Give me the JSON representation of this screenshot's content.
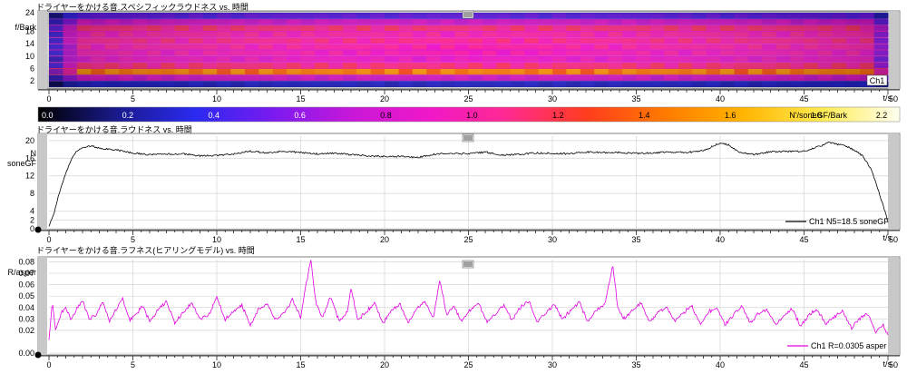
{
  "colors": {
    "panel_border": "#808080",
    "grid": "#d4d4d4",
    "track": "#c8c8c8",
    "loudness_line": "#000000",
    "roughness_line": "#e000e0",
    "ruler": "#000000"
  },
  "icons": {
    "cursor_marker": "cursor-marker-icon",
    "origin_dot": "origin-dot-icon"
  },
  "chart_data": [
    {
      "type": "heatmap",
      "title": "ドライヤーをかける音.スペシフィックラウドネス vs. 時間",
      "ylabel": "f/Bark",
      "xlabel": "t/s",
      "xlim": [
        0,
        50
      ],
      "ylim": [
        0,
        24
      ],
      "yticks": [
        "24",
        "18",
        "14",
        "10",
        "6",
        "2"
      ],
      "xticks": [
        "0",
        "5",
        "10",
        "15",
        "20",
        "25",
        "30",
        "35",
        "40",
        "45",
        "50"
      ],
      "channel_label": "Ch1",
      "colorbar": {
        "ticks": [
          "0.0",
          "0.2",
          "0.4",
          "0.6",
          "0.8",
          "1.0",
          "1.2",
          "1.4",
          "1.6",
          "1.8",
          "2.2"
        ],
        "unit": "N'/soneGF/Bark",
        "range": [
          0,
          2.2
        ],
        "stops": [
          "#000000",
          "#1a1a8c",
          "#2a2af0",
          "#7a1af0",
          "#c818d8",
          "#f018c8",
          "#ff2a90",
          "#ff3c1e",
          "#ff7a00",
          "#ffb400",
          "#ffeb50",
          "#fffff0"
        ]
      },
      "band_intensity": [
        {
          "bark": 1,
          "level": 0.35
        },
        {
          "bark": 3,
          "level": 0.9
        },
        {
          "bark": 5,
          "level": 1.6
        },
        {
          "bark": 7,
          "level": 1.2
        },
        {
          "bark": 9,
          "level": 1.0
        },
        {
          "bark": 11,
          "level": 1.05
        },
        {
          "bark": 13,
          "level": 1.1
        },
        {
          "bark": 15,
          "level": 1.15
        },
        {
          "bark": 17,
          "level": 1.1
        },
        {
          "bark": 19,
          "level": 1.2
        },
        {
          "bark": 21,
          "level": 0.9
        },
        {
          "bark": 23,
          "level": 0.55
        }
      ]
    },
    {
      "type": "line",
      "title": "ドライヤーをかける音.ラウドネス vs. 時間",
      "ylabel": "N\nsoneGF",
      "ylabel_lines": [
        "N",
        "soneGF"
      ],
      "xlabel": "t/s",
      "xlim": [
        0,
        50
      ],
      "ylim": [
        0,
        21
      ],
      "yticks": [
        "20",
        "16",
        "12",
        "8",
        "4",
        "2",
        "0"
      ],
      "xticks": [
        "0",
        "5",
        "10",
        "15",
        "20",
        "25",
        "30",
        "35",
        "40",
        "45",
        "50"
      ],
      "series": [
        {
          "name": "Ch1 N5=18.5 soneGF",
          "x": [
            0.0,
            0.3,
            0.6,
            1.0,
            1.3,
            1.6,
            2.0,
            2.5,
            3.0,
            4,
            5,
            6,
            7,
            8,
            9,
            10,
            11,
            12,
            13,
            14,
            15,
            16,
            17,
            18,
            19,
            20,
            21,
            22,
            23,
            24,
            25,
            26,
            27,
            28,
            29,
            30,
            31,
            32,
            33,
            34,
            35,
            36,
            37,
            38,
            39,
            40,
            40.5,
            41,
            42,
            43,
            44,
            45,
            46,
            46.5,
            47,
            47.5,
            48,
            48.5,
            49.0,
            49.4,
            49.7,
            50.0
          ],
          "y": [
            0.5,
            3.5,
            8.0,
            12.5,
            15.5,
            17.5,
            18.4,
            18.8,
            18.3,
            17.9,
            17.2,
            16.8,
            16.9,
            17.0,
            16.5,
            16.6,
            17.0,
            17.6,
            17.2,
            17.6,
            17.3,
            17.0,
            17.1,
            16.8,
            16.5,
            16.4,
            16.4,
            16.2,
            16.9,
            17.1,
            17.0,
            17.4,
            16.7,
            16.9,
            17.2,
            17.1,
            17.0,
            17.4,
            17.3,
            17.3,
            17.1,
            17.2,
            17.4,
            17.3,
            17.7,
            19.5,
            19.0,
            17.6,
            16.8,
            17.5,
            17.5,
            17.6,
            18.8,
            19.6,
            19.1,
            18.8,
            17.8,
            16.5,
            13.5,
            9.0,
            5.5,
            1.5
          ]
        }
      ]
    },
    {
      "type": "line",
      "title": "ドライヤーをかける音.ラフネス(ヒアリングモデル) vs. 時間",
      "ylabel": "R/asper",
      "xlabel": "t/s",
      "xlim": [
        0,
        50
      ],
      "ylim": [
        0,
        0.082
      ],
      "yticks": [
        "0.08",
        "0.07",
        "0.06",
        "0.05",
        "0.04",
        "0.03",
        "0.02",
        "0.00"
      ],
      "xticks": [
        "0",
        "5",
        "10",
        "15",
        "20",
        "25",
        "30",
        "35",
        "40",
        "45",
        "50"
      ],
      "series": [
        {
          "name": "Ch1 R=0.0305 asper",
          "x": [
            0.0,
            0.2,
            0.4,
            0.7,
            1.0,
            1.3,
            1.6,
            2.0,
            2.4,
            2.8,
            3.2,
            3.6,
            4.0,
            4.4,
            4.8,
            5.2,
            5.6,
            6.0,
            6.5,
            7.0,
            7.5,
            8.0,
            8.5,
            9.0,
            9.5,
            10.0,
            10.5,
            11.0,
            11.5,
            12.0,
            12.5,
            13.0,
            13.5,
            14.0,
            14.5,
            15.0,
            15.3,
            15.6,
            15.9,
            16.3,
            16.8,
            17.3,
            17.8,
            18.0,
            18.4,
            18.9,
            19.4,
            19.9,
            20.4,
            20.9,
            21.4,
            21.9,
            22.4,
            22.9,
            23.3,
            23.7,
            24.1,
            24.6,
            25.1,
            25.6,
            26.1,
            26.6,
            27.1,
            27.6,
            28.1,
            28.6,
            29.1,
            29.6,
            30.1,
            30.6,
            31.1,
            31.6,
            32.1,
            32.6,
            33.1,
            33.6,
            33.9,
            34.3,
            34.8,
            35.3,
            35.8,
            36.3,
            36.8,
            37.3,
            37.8,
            38.3,
            38.8,
            39.3,
            39.8,
            40.3,
            40.8,
            41.3,
            41.8,
            42.3,
            42.8,
            43.3,
            43.8,
            44.3,
            44.8,
            45.3,
            45.8,
            46.3,
            46.8,
            47.3,
            47.8,
            48.3,
            48.8,
            49.3,
            49.7,
            50.0
          ],
          "y": [
            0.012,
            0.045,
            0.02,
            0.034,
            0.041,
            0.029,
            0.037,
            0.046,
            0.03,
            0.033,
            0.045,
            0.028,
            0.038,
            0.048,
            0.029,
            0.034,
            0.042,
            0.027,
            0.039,
            0.045,
            0.026,
            0.036,
            0.044,
            0.03,
            0.033,
            0.049,
            0.029,
            0.037,
            0.042,
            0.025,
            0.038,
            0.044,
            0.029,
            0.034,
            0.047,
            0.031,
            0.058,
            0.082,
            0.045,
            0.031,
            0.05,
            0.027,
            0.038,
            0.057,
            0.029,
            0.036,
            0.044,
            0.026,
            0.037,
            0.043,
            0.027,
            0.038,
            0.046,
            0.03,
            0.065,
            0.033,
            0.041,
            0.028,
            0.038,
            0.044,
            0.027,
            0.035,
            0.042,
            0.029,
            0.04,
            0.046,
            0.027,
            0.035,
            0.043,
            0.03,
            0.037,
            0.045,
            0.028,
            0.038,
            0.042,
            0.077,
            0.04,
            0.03,
            0.038,
            0.044,
            0.027,
            0.036,
            0.041,
            0.028,
            0.035,
            0.042,
            0.026,
            0.036,
            0.04,
            0.025,
            0.034,
            0.041,
            0.026,
            0.035,
            0.038,
            0.024,
            0.033,
            0.039,
            0.023,
            0.034,
            0.038,
            0.025,
            0.032,
            0.037,
            0.022,
            0.03,
            0.035,
            0.018,
            0.025,
            0.016
          ]
        }
      ]
    }
  ]
}
